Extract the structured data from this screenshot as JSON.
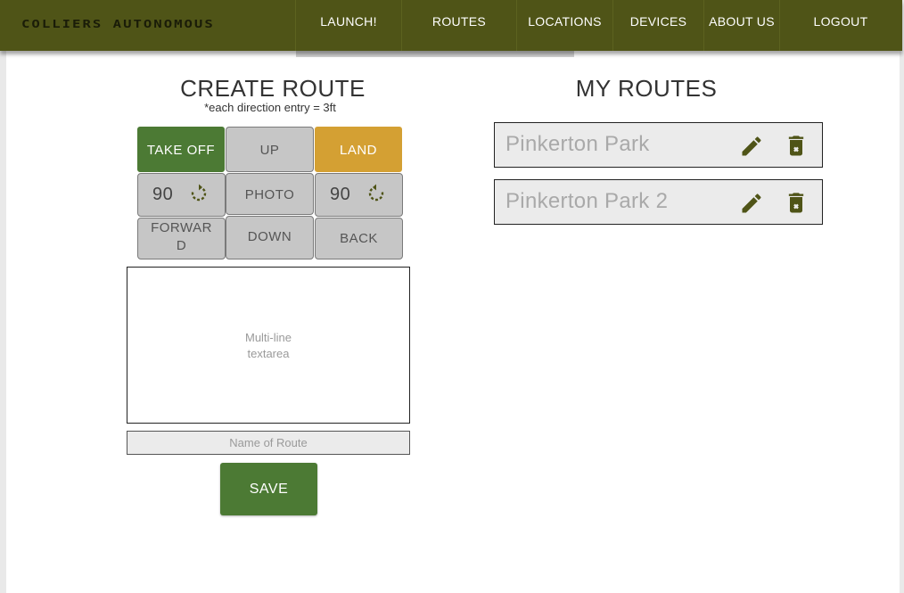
{
  "navbar": {
    "brand": "COLLIERS AUTONOMOUS",
    "items": [
      {
        "label": "LAUNCH!"
      },
      {
        "label": "ROUTES"
      },
      {
        "label": "LOCATIONS"
      },
      {
        "label": "DEVICES"
      },
      {
        "label": "ABOUT US"
      },
      {
        "label": "LOGOUT"
      }
    ],
    "bg_color": "#4f5417"
  },
  "create_route": {
    "title": "CREATE ROUTE",
    "subtitle": "*each direction entry = 3ft",
    "controls": {
      "take_off": "TAKE OFF",
      "up": "UP",
      "land": "LAND",
      "rotate_cw_value": "90",
      "rotate_cw_icon": "rotate-clockwise-icon",
      "photo": "PHOTO",
      "rotate_ccw_value": "90",
      "rotate_ccw_icon": "rotate-counterclockwise-icon",
      "forward": "FORWARD",
      "down": "DOWN",
      "back": "BACK"
    },
    "textarea_placeholder": "Multi-line textarea",
    "textarea_placeholder_line1": "Multi-line",
    "textarea_placeholder_line2": "textarea",
    "name_placeholder": "Name of Route",
    "save": "SAVE",
    "colors": {
      "primary_green": "#4c7a34",
      "land_orange": "#d4a033",
      "button_gray": "#c6c6c6"
    }
  },
  "my_routes": {
    "title": "MY ROUTES",
    "routes": [
      {
        "name": "Pinkerton Park",
        "edit_icon": "pencil-icon",
        "delete_icon": "trash-icon"
      },
      {
        "name": "Pinkerton Park 2",
        "edit_icon": "pencil-icon",
        "delete_icon": "trash-icon"
      }
    ],
    "icon_color": "#4f5417"
  }
}
